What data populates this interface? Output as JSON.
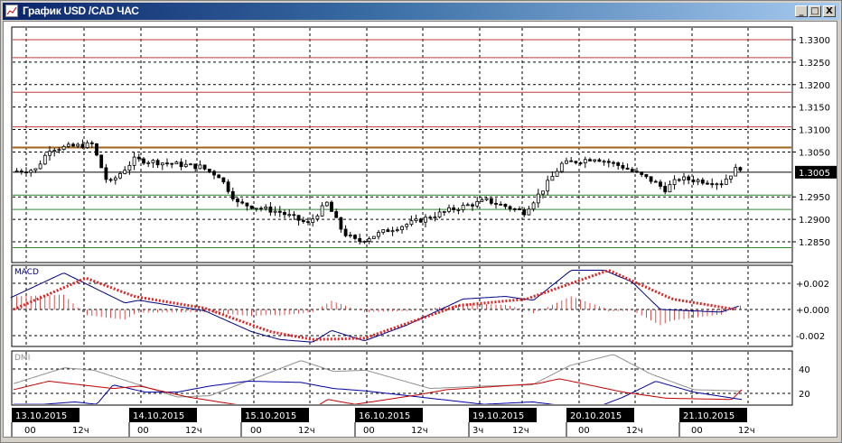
{
  "window": {
    "title": "График USD /CAD  ЧАС",
    "minimize_label": "_",
    "maximize_label": "□",
    "close_label": "X"
  },
  "colors": {
    "resistance": "#c0393b",
    "pivot": "#a0631c",
    "support": "#2e8b2e",
    "macd_main": "#000080",
    "macd_signal": "#e02020",
    "macd_hist": "#e02020",
    "dmi_adx": "#909090",
    "dmi_plus": "#0000a0",
    "dmi_minus": "#c00000"
  },
  "price_panel": {
    "axis_labels": [
      "1.3300",
      "1.3250",
      "1.3200",
      "1.3150",
      "1.3100",
      "1.3050",
      "1.2950",
      "1.2900",
      "1.2850"
    ],
    "axis_values": [
      1.33,
      1.325,
      1.32,
      1.315,
      1.31,
      1.305,
      1.295,
      1.29,
      1.285
    ],
    "current_price_label": "1.3005",
    "current_price": 1.3005,
    "levels": [
      {
        "type": "resistance",
        "price": 1.33
      },
      {
        "type": "resistance",
        "price": 1.326
      },
      {
        "type": "resistance",
        "price": 1.3183
      },
      {
        "type": "resistance",
        "price": 1.3106
      },
      {
        "type": "pivot",
        "price": 1.306
      },
      {
        "type": "support",
        "price": 1.2954
      },
      {
        "type": "support",
        "price": 1.2922
      },
      {
        "type": "support",
        "price": 1.2837
      }
    ],
    "price_path": [
      [
        -3,
        1.3007
      ],
      [
        2,
        1.3011
      ],
      [
        5,
        1.3057
      ],
      [
        14,
        1.3067
      ],
      [
        17.5,
        1.2977
      ],
      [
        23,
        1.3033
      ],
      [
        37,
        1.3017
      ],
      [
        41,
        1.2997
      ],
      [
        45,
        1.2936
      ],
      [
        54,
        1.2916
      ],
      [
        60,
        1.289
      ],
      [
        64,
        1.2936
      ],
      [
        67.5,
        1.287
      ],
      [
        70.5,
        1.285
      ],
      [
        77,
        1.2876
      ],
      [
        85,
        1.2902
      ],
      [
        90.5,
        1.2922
      ],
      [
        98,
        1.2942
      ],
      [
        106,
        1.2916
      ],
      [
        110,
        1.2967
      ],
      [
        114,
        1.3023
      ],
      [
        121,
        1.3037
      ],
      [
        127,
        1.3017
      ],
      [
        133,
        1.2987
      ],
      [
        136,
        1.2967
      ],
      [
        139,
        1.2991
      ],
      [
        148,
        1.2981
      ],
      [
        151,
        1.3011
      ],
      [
        152.5,
        1.3017
      ]
    ]
  },
  "macd_panel": {
    "label": "MACD",
    "axis_labels": [
      "+0.002",
      "+0.000",
      "-0.002"
    ],
    "axis_values": [
      0.002,
      0,
      -0.002
    ],
    "main": [
      [
        -3.3,
        0.0009
      ],
      [
        8,
        0.0028
      ],
      [
        21,
        0.0005
      ],
      [
        24,
        0.0007
      ],
      [
        38,
        -0.0001
      ],
      [
        48,
        -0.0017
      ],
      [
        54,
        -0.0023
      ],
      [
        61,
        -0.0025
      ],
      [
        65,
        -0.0016
      ],
      [
        72,
        -0.0024
      ],
      [
        81,
        -0.0012
      ],
      [
        93,
        0.0008
      ],
      [
        102,
        0.001
      ],
      [
        108,
        0.0007
      ],
      [
        116,
        0.003
      ],
      [
        123,
        0.003
      ],
      [
        129,
        0.0021
      ],
      [
        135,
        0.0
      ],
      [
        148,
        -0.0002
      ],
      [
        152,
        0.0003
      ]
    ],
    "signal": [
      [
        -2.7,
        0.0
      ],
      [
        12.7,
        0.0024
      ],
      [
        23,
        0.001
      ],
      [
        38,
        0.0001
      ],
      [
        52,
        -0.0017
      ],
      [
        61,
        -0.0023
      ],
      [
        72,
        -0.0022
      ],
      [
        92,
        0.0003
      ],
      [
        106.5,
        0.0008
      ],
      [
        124,
        0.003
      ],
      [
        137.5,
        0.0008
      ],
      [
        151,
        0.0
      ]
    ]
  },
  "dmi_panel": {
    "label": "DMI",
    "axis_labels": [
      "40",
      "20"
    ],
    "axis_values": [
      40,
      20
    ],
    "adx": [
      [
        -2.7,
        28
      ],
      [
        8.1,
        41
      ],
      [
        14.4,
        39
      ],
      [
        32.1,
        17
      ],
      [
        39,
        18
      ],
      [
        58.5,
        47
      ],
      [
        65.4,
        38
      ],
      [
        72.3,
        39
      ],
      [
        86,
        24
      ],
      [
        97.5,
        26
      ],
      [
        107.7,
        27
      ],
      [
        115.8,
        43
      ],
      [
        125,
        52
      ],
      [
        132.9,
        36
      ],
      [
        142.1,
        23
      ],
      [
        152.3,
        22
      ]
    ],
    "plus_di": [
      [
        -2.7,
        11
      ],
      [
        3.7,
        11
      ],
      [
        10.4,
        13
      ],
      [
        15,
        11
      ],
      [
        18.5,
        27
      ],
      [
        25.4,
        21
      ],
      [
        32.1,
        21
      ],
      [
        39,
        26
      ],
      [
        47.1,
        30
      ],
      [
        58.5,
        29
      ],
      [
        65.4,
        24
      ],
      [
        72.3,
        22
      ],
      [
        86,
        16
      ],
      [
        97.5,
        11
      ],
      [
        107.7,
        13
      ],
      [
        120.4,
        7
      ],
      [
        127.1,
        17
      ],
      [
        134,
        30
      ],
      [
        142.1,
        21
      ],
      [
        152.3,
        15
      ]
    ],
    "minus_di": [
      [
        -2.7,
        23
      ],
      [
        4.8,
        30
      ],
      [
        18.5,
        24
      ],
      [
        24.2,
        26
      ],
      [
        34.4,
        17
      ],
      [
        46,
        10
      ],
      [
        60.8,
        7
      ],
      [
        64.2,
        15
      ],
      [
        70,
        11
      ],
      [
        83.7,
        19
      ],
      [
        89.4,
        23
      ],
      [
        108.8,
        28
      ],
      [
        113.5,
        32
      ],
      [
        127.1,
        21
      ],
      [
        136.3,
        16
      ],
      [
        150.2,
        15
      ],
      [
        152.3,
        23
      ]
    ]
  },
  "time_axis": {
    "dates": [
      "13.10.2015",
      "14.10.2015",
      "15.10.2015",
      "16.10.2015",
      "19.10.2015",
      "20.10.2015",
      "21.10.2015"
    ],
    "hour_labels": [
      [
        "00",
        "12ч"
      ],
      [
        "00",
        "12ч"
      ],
      [
        "00",
        "12ч"
      ],
      [
        "00",
        "12ч"
      ],
      [
        "3ч",
        "12ч"
      ],
      [
        "00",
        "12ч"
      ],
      [
        "00",
        "12ч"
      ]
    ]
  }
}
